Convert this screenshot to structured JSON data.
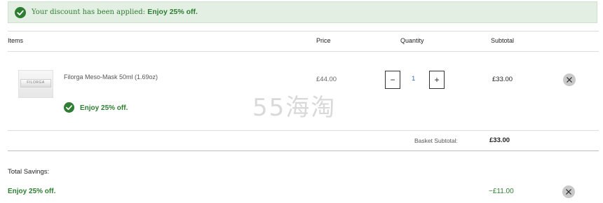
{
  "banner": {
    "message": "Your discount has been applied:",
    "offer": "Enjoy 25% off."
  },
  "table": {
    "headers": {
      "items": "Items",
      "price": "Price",
      "quantity": "Quantity",
      "subtotal": "Subtotal"
    }
  },
  "item": {
    "thumbnail_brand": "FILORGA",
    "name": "Filorga Meso-Mask 50ml (1.69oz)",
    "offer": "Enjoy 25% off.",
    "price": "£44.00",
    "quantity": "1",
    "minus_label": "−",
    "plus_label": "+",
    "subtotal": "£33.00"
  },
  "watermark": "55海淘",
  "basket": {
    "label": "Basket Subtotal:",
    "value": "£33.00"
  },
  "savings": {
    "title": "Total Savings:",
    "offer": "Enjoy 25% off.",
    "value": "−£11.00"
  },
  "colors": {
    "accent_green": "#2e7d32",
    "banner_bg": "#e3efe2",
    "remove_bg": "#c9c9c9"
  }
}
